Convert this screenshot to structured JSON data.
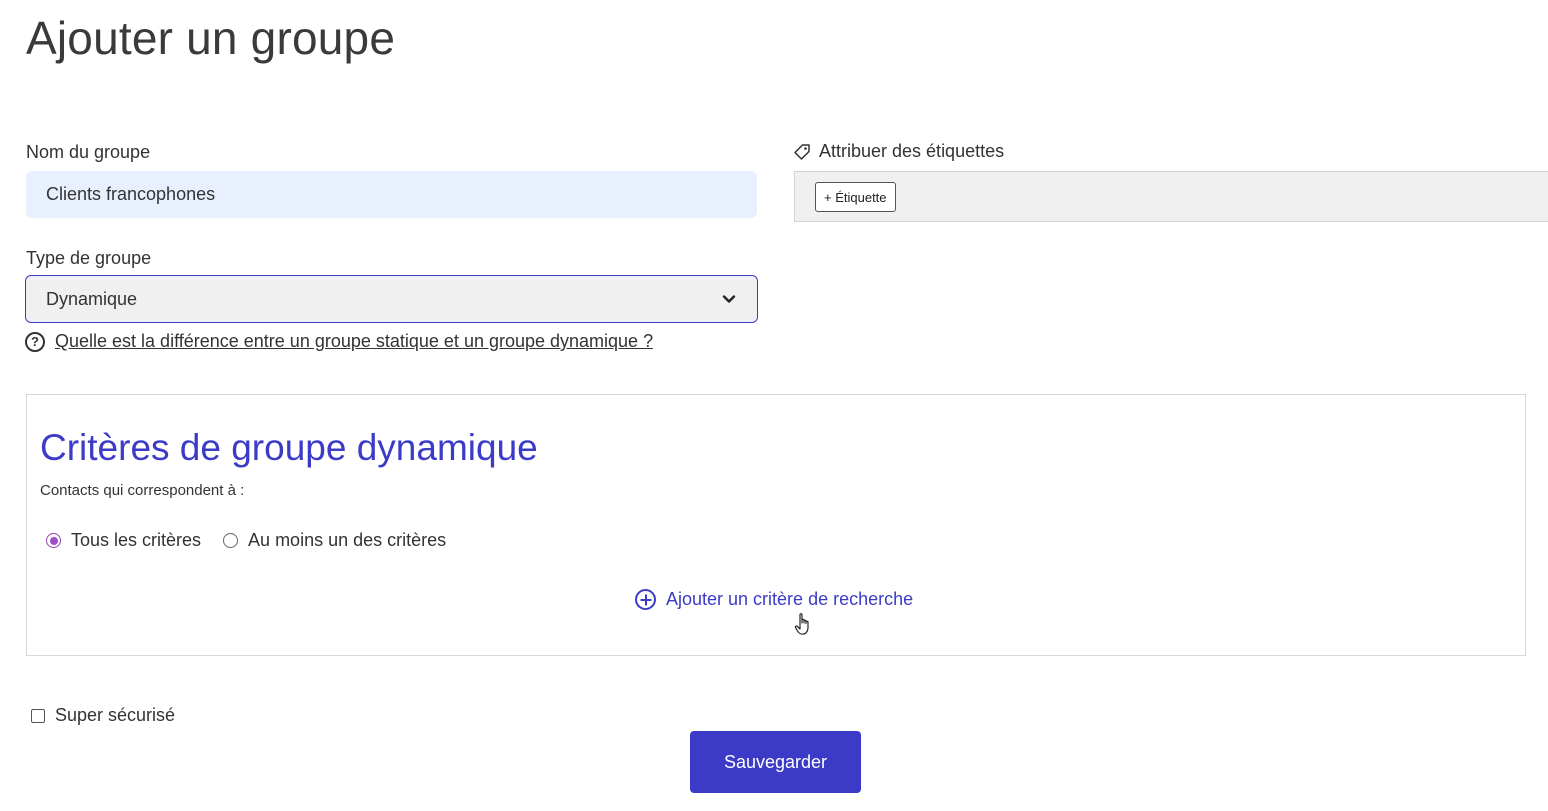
{
  "page": {
    "title": "Ajouter un groupe"
  },
  "group_name": {
    "label": "Nom du groupe",
    "value": "Clients francophones"
  },
  "group_type": {
    "label": "Type de groupe",
    "selected": "Dynamique",
    "help_link": "Quelle est la différence entre un groupe statique et un groupe dynamique ?",
    "help_icon": "question-circle-icon",
    "dropdown_icon": "chevron-down-icon"
  },
  "tags": {
    "label": "Attribuer des étiquettes",
    "icon": "tag-icon",
    "add_button": "+ Étiquette"
  },
  "criteria": {
    "title": "Critères de groupe dynamique",
    "subtitle": "Contacts qui correspondent à :",
    "options": [
      {
        "label": "Tous les critères",
        "checked": true
      },
      {
        "label": "Au moins un des critères",
        "checked": false
      }
    ],
    "add_label": "Ajouter un critère de recherche",
    "add_icon": "plus-circle-icon"
  },
  "secure": {
    "label": "Super sécurisé",
    "checked": false
  },
  "actions": {
    "save_label": "Sauvegarder"
  },
  "colors": {
    "accent": "#3b3bc7",
    "radio_selected": "#9b4dca",
    "input_bg": "#e8f0fe",
    "select_bg": "#f0f0f0"
  }
}
